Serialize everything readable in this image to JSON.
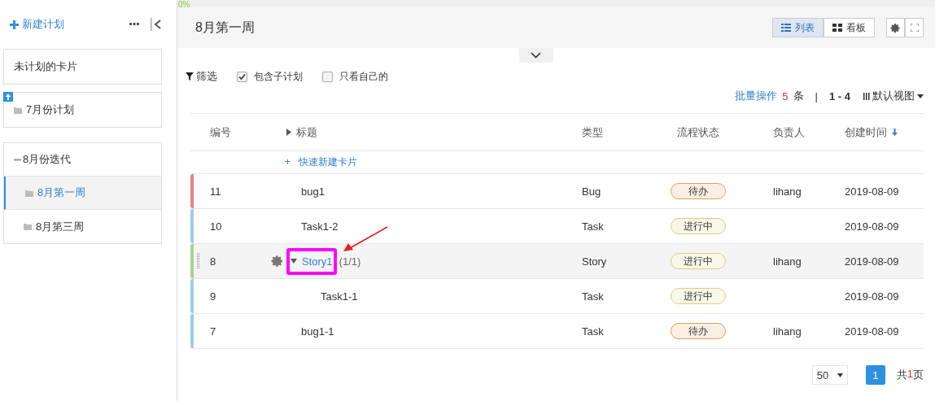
{
  "progress": {
    "label": "0%",
    "level": 0
  },
  "sidebar": {
    "new_plan": "新建计划",
    "plans": [
      {
        "label": "未计划的卡片",
        "kind": "plain",
        "selected": false
      },
      {
        "label": "7月份计划",
        "kind": "plan",
        "pinned": true,
        "selected": false
      },
      {
        "label": "8月份迭代",
        "kind": "group",
        "expanded": true,
        "selected": false,
        "children": [
          {
            "label": "8月第一周",
            "selected": true
          },
          {
            "label": "8月第三周",
            "selected": false
          }
        ]
      }
    ]
  },
  "header": {
    "title": "8月第一周",
    "panel_expanded": false,
    "views": [
      {
        "label": "列表",
        "kind": "list",
        "selected": true
      },
      {
        "label": "看板",
        "kind": "board",
        "selected": false
      }
    ]
  },
  "filters": {
    "label": "筛选",
    "checkboxes": [
      {
        "label": "包含子计划",
        "checked": true
      },
      {
        "label": "只看自己的",
        "checked": false
      }
    ]
  },
  "batch": {
    "label": "批量操作",
    "count": "5",
    "unit": "条",
    "separator": "|",
    "range": "1 - 4",
    "view": "默认视图"
  },
  "table": {
    "columns": [
      {
        "label": "编号",
        "sorted": false
      },
      {
        "label": "标题",
        "sorted": false
      },
      {
        "label": "类型",
        "sorted": false
      },
      {
        "label": "流程状态",
        "sorted": false
      },
      {
        "label": "负责人",
        "sorted": false
      },
      {
        "label": "创建时间",
        "sorted": true
      }
    ],
    "quick_add": {
      "icon": "+",
      "label": "快速新建卡片"
    },
    "rows": [
      {
        "id": "11",
        "title": "bug1",
        "type": "Bug",
        "status": "待办",
        "kind": "todo",
        "owner": "lihang",
        "date": "2019-08-09",
        "color": "#e8808a",
        "hovered": false
      },
      {
        "id": "10",
        "title": "Task1-2",
        "type": "Task",
        "status": "进行中",
        "kind": "doing",
        "date": "2019-08-09",
        "color": "#9ccbe8",
        "hovered": false
      },
      {
        "id": "8",
        "title": "Story1",
        "count": "(1/1)",
        "type": "Story",
        "status": "进行中",
        "kind": "doing",
        "owner": "lihang",
        "date": "2019-08-09",
        "color": "#a6d38a",
        "hovered": true,
        "annotated": true,
        "expanded": true,
        "children": [
          {
            "id": "9",
            "title": "Task1-1",
            "type": "Task",
            "status": "进行中",
            "kind": "doing",
            "date": "2019-08-09",
            "color": "#9ccbe8",
            "hovered": false
          }
        ]
      },
      {
        "id": "7",
        "title": "bug1-1",
        "type": "Task",
        "status": "待办",
        "kind": "todo",
        "owner": "lihang",
        "date": "2019-08-09",
        "color": "#9ccbe8",
        "hovered": false
      }
    ]
  },
  "pagination": {
    "page_size": "50",
    "pages": [
      {
        "label": "1",
        "selected": true
      }
    ],
    "total_prefix": "共",
    "total": "1",
    "total_suffix": "页"
  }
}
